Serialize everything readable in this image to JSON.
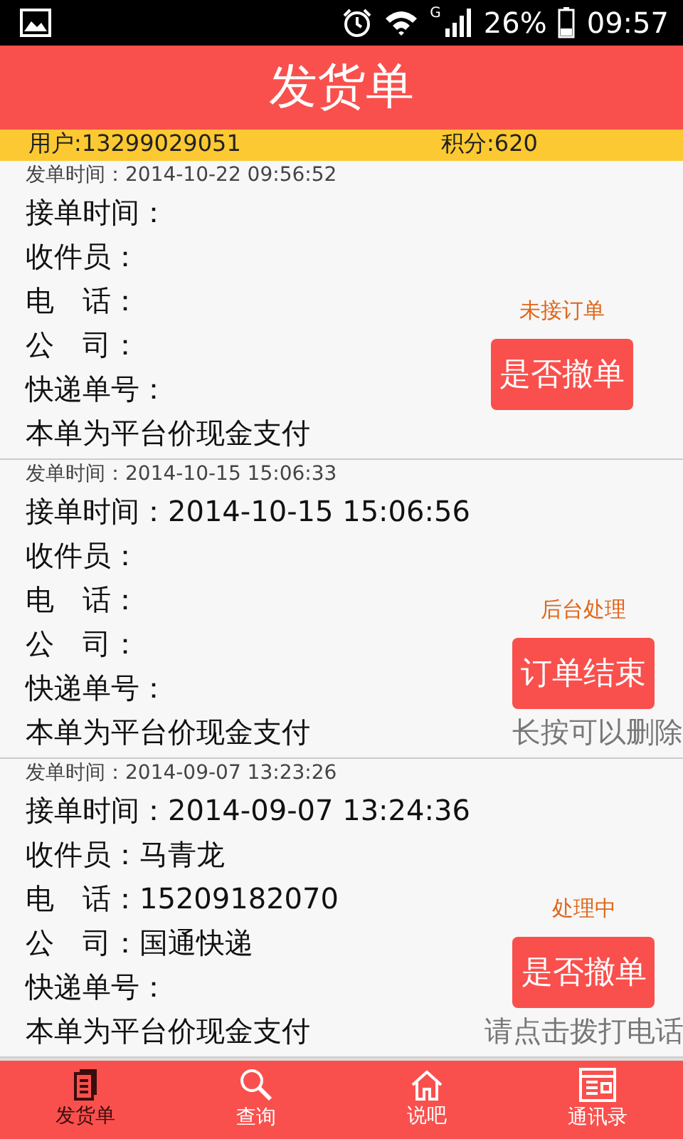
{
  "status_bar": {
    "network": "G",
    "battery": "26%",
    "time": "09:57"
  },
  "header": {
    "title": "发货单"
  },
  "account": {
    "user": "用户:13299029051",
    "points": "积分:620"
  },
  "orders": [
    {
      "sent_time": "发单时间：2014-10-22 09:56:52",
      "lines": [
        "接单时间：",
        "收件员：",
        "电　话：",
        "公　司：",
        "快递单号：",
        "本单为平台价现金支付"
      ],
      "status": "未接订单",
      "action": "是否撤单"
    },
    {
      "sent_time": "发单时间：2014-10-15 15:06:33",
      "lines": [
        "接单时间：2014-10-15 15:06:56",
        "收件员：",
        "电　话：",
        "公　司：",
        "快递单号：",
        "本单为平台价现金支付"
      ],
      "status": "后台处理",
      "action": "订单结束",
      "hint": "长按可以删除"
    },
    {
      "sent_time": "发单时间：2014-09-07 13:23:26",
      "lines": [
        "接单时间：2014-09-07 13:24:36",
        "收件员：马青龙",
        "电　话：15209182070",
        "公　司：国通快递",
        "快递单号：",
        "本单为平台价现金支付"
      ],
      "status": "处理中",
      "action": "是否撤单",
      "hint": "请点击拨打电话"
    }
  ],
  "tabs": [
    {
      "kind": "document",
      "label": "发货单",
      "selected": true
    },
    {
      "kind": "search",
      "label": "查询",
      "selected": false
    },
    {
      "kind": "home",
      "label": "说吧",
      "selected": false
    },
    {
      "kind": "contacts",
      "label": "通讯录",
      "selected": false
    }
  ]
}
